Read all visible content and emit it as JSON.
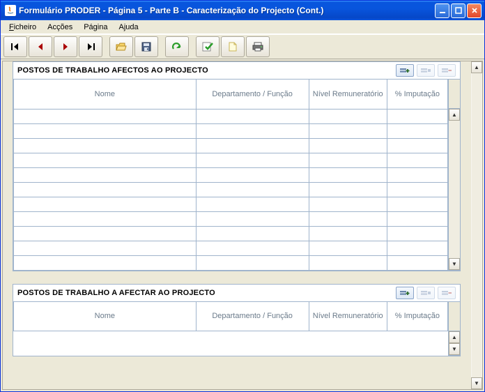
{
  "window": {
    "title": "Formulário PRODER - Página 5 - Parte B - Caracterização do Projecto (Cont.)"
  },
  "menu": {
    "ficheiro": "Ficheiro",
    "accoes": "Acções",
    "pagina": "Página",
    "ajuda": "Ajuda"
  },
  "toolbar_icons": {
    "first": "first-page-icon",
    "prev": "prev-page-icon",
    "next": "next-page-icon",
    "last": "last-page-icon",
    "open": "open-icon",
    "save": "save-icon",
    "redo": "redo-icon",
    "validate": "validate-icon",
    "new": "new-icon",
    "print": "print-icon"
  },
  "panels": [
    {
      "title": "POSTOS DE TRABALHO AFECTOS AO PROJECTO",
      "columns": {
        "nome": "Nome",
        "dep": "Departamento / Função",
        "nivel": "Nível Remuneratório",
        "imp": "% Imputação"
      },
      "rows": 11
    },
    {
      "title": "POSTOS DE TRABALHO A AFECTAR AO PROJECTO",
      "columns": {
        "nome": "Nome",
        "dep": "Departamento / Função",
        "nivel": "Nível Remuneratório",
        "imp": "% Imputação"
      },
      "rows": 0
    }
  ]
}
